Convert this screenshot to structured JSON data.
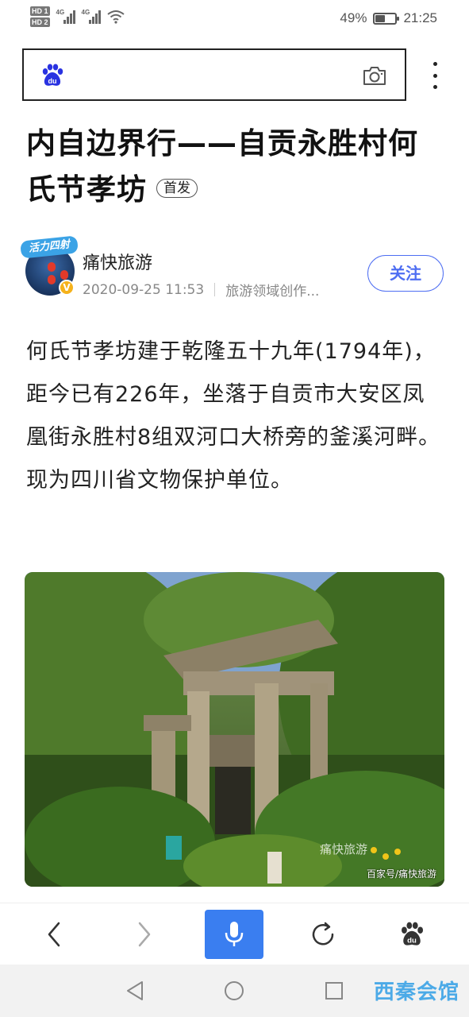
{
  "status_bar": {
    "hd1": "HD 1",
    "hd2": "HD 2",
    "sig1": "4G",
    "sig2": "4G",
    "battery_text": "49%",
    "battery_level": 0.49,
    "time": "21:25"
  },
  "search": {
    "logo_icon": "baidu-paw-icon",
    "camera_icon": "camera-icon",
    "more_icon": "more-vertical-icon"
  },
  "article": {
    "title": "内自边界行——自贡永胜村何氏节孝坊",
    "badge": "首发",
    "author": {
      "banner": "活力四射",
      "name": "痛快旅游",
      "date": "2020-09-25 11:53",
      "field": "旅游领域创作...",
      "verified_mark": "V",
      "follow_label": "关注"
    },
    "body": "何氏节孝坊建于乾隆五十九年(1794年)，距今已有226年，坐落于自贡市大安区凤凰街永胜村8组双河口大桥旁的釜溪河畔。现为四川省文物保护单位。",
    "image": {
      "caption": "百家号/痛快旅游",
      "watermark": "痛快旅游"
    }
  },
  "toolbar": {
    "back_icon": "chevron-left-icon",
    "forward_icon": "chevron-right-icon",
    "voice_icon": "microphone-icon",
    "refresh_icon": "refresh-icon",
    "home_icon": "baidu-paw-icon"
  },
  "nav": {
    "corner_logo": "西秦会馆"
  },
  "colors": {
    "accent": "#4e6ef2",
    "voice": "#3a7ef0",
    "baidu_blue": "#2932e1"
  }
}
